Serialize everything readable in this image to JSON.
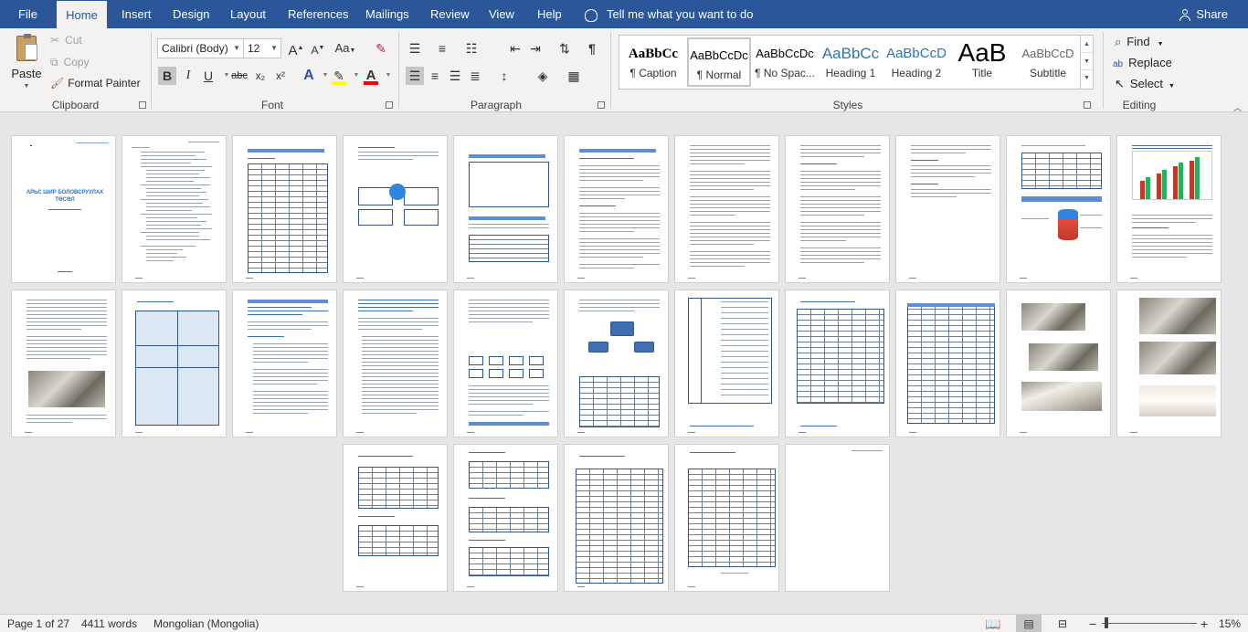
{
  "tabs": [
    "File",
    "Home",
    "Insert",
    "Design",
    "Layout",
    "References",
    "Mailings",
    "Review",
    "View",
    "Help"
  ],
  "tell_me": "Tell me what you want to do",
  "share": "Share",
  "clipboard": {
    "paste": "Paste",
    "cut": "Cut",
    "copy": "Copy",
    "format_painter": "Format Painter",
    "label": "Clipboard"
  },
  "font": {
    "family": "Calibri (Body)",
    "size": "12",
    "label": "Font",
    "bold": "B",
    "italic": "I",
    "underline": "U",
    "strike": "abc",
    "subscript": "x₂",
    "superscript": "x²",
    "grow": "A",
    "shrink": "A",
    "case": "Aa"
  },
  "paragraph": {
    "label": "Paragraph"
  },
  "styles": {
    "label": "Styles",
    "items": [
      {
        "preview": "AaBbCc",
        "name": "¶ Caption"
      },
      {
        "preview": "AaBbCcDc",
        "name": "¶ Normal"
      },
      {
        "preview": "AaBbCcDc",
        "name": "¶ No Spac..."
      },
      {
        "preview": "AaBbCc",
        "name": "Heading 1"
      },
      {
        "preview": "AaBbCcD",
        "name": "Heading 2"
      },
      {
        "preview": "AaB",
        "name": "Title"
      },
      {
        "preview": "AaBbCcD",
        "name": "Subtitle"
      }
    ]
  },
  "editing": {
    "find": "Find",
    "replace": "Replace",
    "select": "Select",
    "label": "Editing"
  },
  "document": {
    "cover_title": "АРЬС ШИР БОЛОВСРУУЛАХ ТӨСӨЛ"
  },
  "status": {
    "page": "Page 1 of 27",
    "words": "4411 words",
    "language": "Mongolian (Mongolia)",
    "zoom": "15%",
    "zoom_level": 0.15
  },
  "colors": {
    "accent": "#2b579a",
    "highlight": "#ffff00",
    "font_color": "#ff0000"
  }
}
